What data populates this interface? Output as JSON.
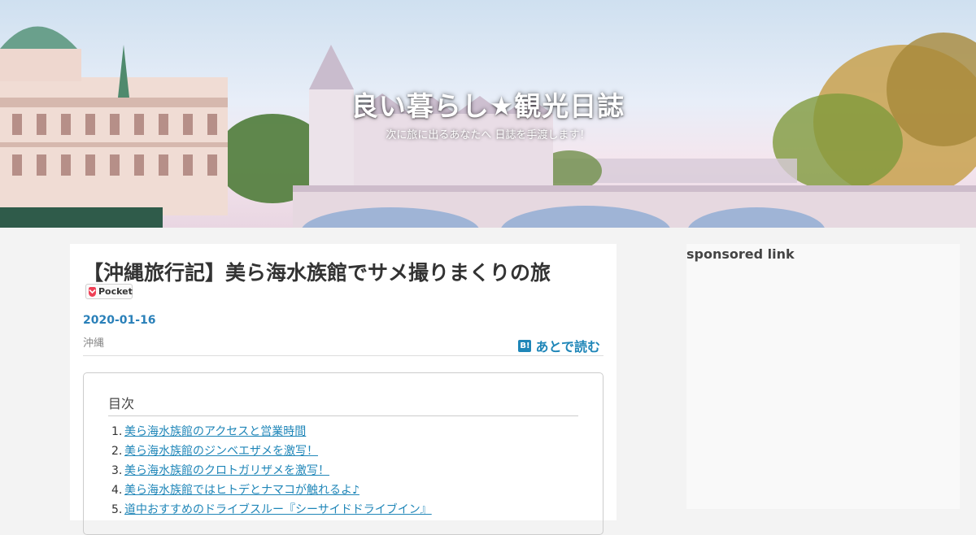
{
  "header": {
    "site_title": "良い暮らし★観光日誌",
    "site_description": "次に旅に出るあなたへ 日誌を手渡します！"
  },
  "article": {
    "title": "【沖縄旅行記】美ら海水族館でサメ撮りまくりの旅",
    "pocket_label": "Pocket",
    "date": "2020-01-16",
    "category": "沖縄",
    "hatena_icon_text": "B!",
    "hatena_label": "あとで読む"
  },
  "toc": {
    "title": "目次",
    "items": [
      {
        "num": "1.",
        "label": "美ら海水族館のアクセスと営業時間"
      },
      {
        "num": "2.",
        "label": "美ら海水族館のジンベエザメを激写！"
      },
      {
        "num": "3.",
        "label": "美ら海水族館のクロトガリザメを激写！"
      },
      {
        "num": "4.",
        "label": "美ら海水族館ではヒトデとナマコが触れるよ♪"
      },
      {
        "num": "5.",
        "label": "道中おすすめのドライブスルー『シーサイドドライブイン』"
      }
    ]
  },
  "sidebar": {
    "title": "sponsored link"
  },
  "colors": {
    "link": "#1f86b8",
    "date": "#2a80b9",
    "pocket": "#ef4056"
  }
}
